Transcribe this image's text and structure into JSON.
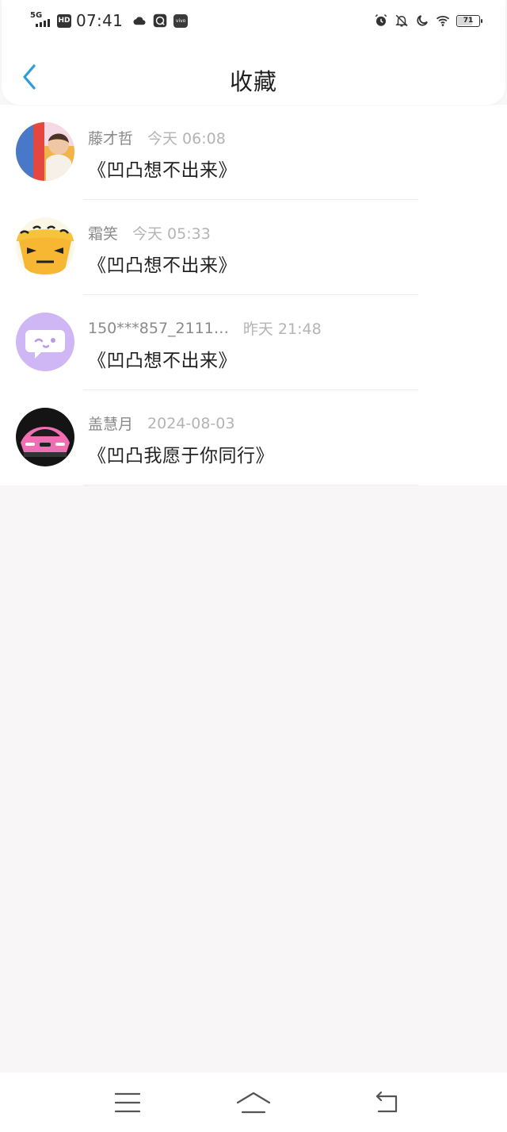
{
  "status_bar": {
    "network": "5G",
    "hd": "HD",
    "time": "07:41",
    "vivo_label": "vivo",
    "battery_level": 71,
    "battery_text": "71",
    "icons": [
      "cloud-icon",
      "browser-app-icon",
      "vivo-app-icon",
      "alarm-icon",
      "mute-bell-icon",
      "moon-icon",
      "wifi-icon",
      "battery-icon"
    ]
  },
  "header": {
    "title": "收藏",
    "back_icon": "chevron-left-icon",
    "accent_color": "#2d9cdb"
  },
  "items": [
    {
      "name": "藤才哲",
      "time": "今天 06:08",
      "title": "《凹凸想不出来》",
      "avatar": "photo-avatar"
    },
    {
      "name": "霜笑",
      "time": "今天 05:33",
      "title": "《凹凸想不出来》",
      "avatar": "cartoon-avatar"
    },
    {
      "name": "150***857_2111…",
      "time": "昨天 21:48",
      "title": "《凹凸想不出来》",
      "avatar": "default-chat-avatar"
    },
    {
      "name": "盖慧月",
      "time": "2024-08-03",
      "title": "《凹凸我愿于你同行》",
      "avatar": "car-avatar"
    }
  ],
  "nav": {
    "icons": [
      "menu-icon",
      "home-icon",
      "back-icon"
    ]
  }
}
